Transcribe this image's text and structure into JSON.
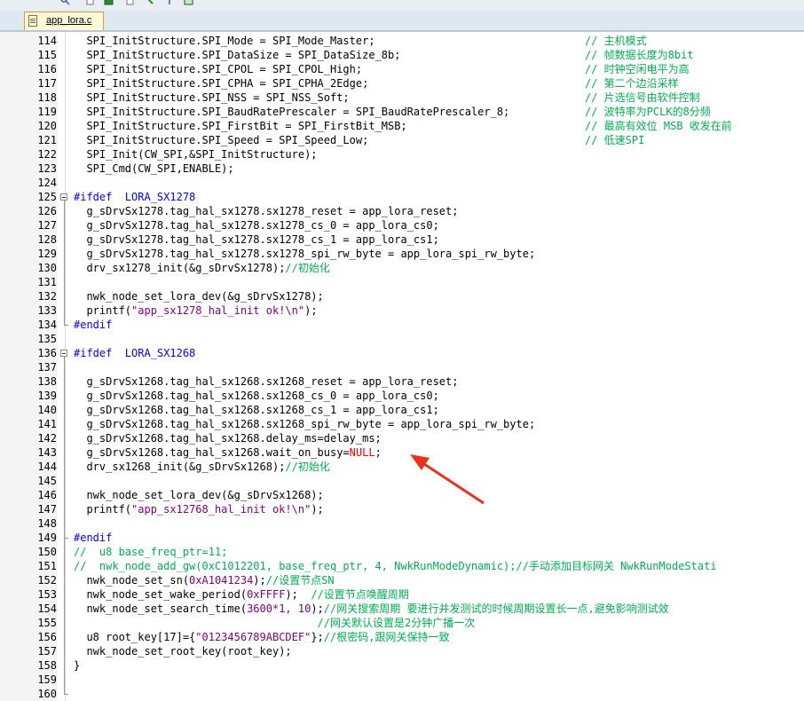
{
  "tab": {
    "label": "app_lora.c"
  },
  "toolbar": {
    "icons": [
      "find-icon",
      "page-icon",
      "bookmark-icon",
      "down-icon",
      "wrench-icon",
      "window-icon"
    ]
  },
  "colors": {
    "code": "#000000",
    "comment": "#00b050",
    "preprocessor": "#0000ff",
    "string": "#800080",
    "null": "#ff0000",
    "arrow": "#e8341c"
  },
  "lines": [
    {
      "n": "114",
      "code": "  SPI_InitStructure.SPI_Mode = SPI_Mode_Master;",
      "comment": "// 主机模式"
    },
    {
      "n": "115",
      "code": "  SPI_InitStructure.SPI_DataSize = SPI_DataSize_8b;",
      "comment": "// 帧数据长度为8bit"
    },
    {
      "n": "116",
      "code": "  SPI_InitStructure.SPI_CPOL = SPI_CPOL_High;",
      "comment": "// 时钟空闲电平为高"
    },
    {
      "n": "117",
      "code": "  SPI_InitStructure.SPI_CPHA = SPI_CPHA_2Edge;",
      "comment": "// 第二个边沿采样"
    },
    {
      "n": "118",
      "code": "  SPI_InitStructure.SPI_NSS = SPI_NSS_Soft;",
      "comment": "// 片选信号由软件控制"
    },
    {
      "n": "119",
      "code": "  SPI_InitStructure.SPI_BaudRatePrescaler = SPI_BaudRatePrescaler_8;",
      "comment": "// 波特率为PCLK的8分频"
    },
    {
      "n": "120",
      "code": "  SPI_InitStructure.SPI_FirstBit = SPI_FirstBit_MSB;",
      "comment": "// 最高有效位 MSB 收发在前"
    },
    {
      "n": "121",
      "code": "  SPI_InitStructure.SPI_Speed = SPI_Speed_Low;",
      "comment": "// 低速SPI"
    },
    {
      "n": "122",
      "code": "  SPI_Init(CW_SPI,&SPI_InitStructure);"
    },
    {
      "n": "123",
      "code": "  SPI_Cmd(CW_SPI,ENABLE);"
    },
    {
      "n": "124",
      "code": ""
    },
    {
      "n": "125",
      "code": "#ifdef  LORA_SX1278",
      "pp": true
    },
    {
      "n": "126",
      "code": "  g_sDrvSx1278.tag_hal_sx1278.sx1278_reset = app_lora_reset;"
    },
    {
      "n": "127",
      "code": "  g_sDrvSx1278.tag_hal_sx1278.sx1278_cs_0 = app_lora_cs0;"
    },
    {
      "n": "128",
      "code": "  g_sDrvSx1278.tag_hal_sx1278.sx1278_cs_1 = app_lora_cs1;"
    },
    {
      "n": "129",
      "code": "  g_sDrvSx1278.tag_hal_sx1278.sx1278_spi_rw_byte = app_lora_spi_rw_byte;"
    },
    {
      "n": "130",
      "code": "  drv_sx1278_init(&g_sDrvSx1278);",
      "tail": "//初始化"
    },
    {
      "n": "131",
      "code": ""
    },
    {
      "n": "132",
      "code": "  nwk_node_set_lora_dev(&g_sDrvSx1278);"
    },
    {
      "n": "133",
      "code": "  printf(",
      "str": "\"app_sx1278_hal_init ok!\\n\"",
      "after": ");"
    },
    {
      "n": "134",
      "code": "#endif",
      "pp": true
    },
    {
      "n": "135",
      "code": ""
    },
    {
      "n": "136",
      "code": "#ifdef  LORA_SX1268",
      "pp": true
    },
    {
      "n": "137",
      "code": ""
    },
    {
      "n": "138",
      "code": "  g_sDrvSx1268.tag_hal_sx1268.sx1268_reset = app_lora_reset;"
    },
    {
      "n": "139",
      "code": "  g_sDrvSx1268.tag_hal_sx1268.sx1268_cs_0 = app_lora_cs0;"
    },
    {
      "n": "140",
      "code": "  g_sDrvSx1268.tag_hal_sx1268.sx1268_cs_1 = app_lora_cs1;"
    },
    {
      "n": "141",
      "code": "  g_sDrvSx1268.tag_hal_sx1268.sx1268_spi_rw_byte = app_lora_spi_rw_byte;"
    },
    {
      "n": "142",
      "code": "  g_sDrvSx1268.tag_hal_sx1268.delay_ms=delay_ms;"
    },
    {
      "n": "143",
      "code": "  g_sDrvSx1268.tag_hal_sx1268.wait_on_busy=",
      "null": "NULL",
      "after": ";"
    },
    {
      "n": "144",
      "code": "  drv_sx1268_init(&g_sDrvSx1268);",
      "tail": "//初始化"
    },
    {
      "n": "145",
      "code": ""
    },
    {
      "n": "146",
      "code": "  nwk_node_set_lora_dev(&g_sDrvSx1268);"
    },
    {
      "n": "147",
      "code": "  printf(",
      "str": "\"app_sx12768_hal_init ok!\\n\"",
      "after": ");"
    },
    {
      "n": "148",
      "code": ""
    },
    {
      "n": "149",
      "code": "#endif",
      "pp": true
    },
    {
      "n": "150",
      "code": "//  u8 base_freq_ptr=11;",
      "allcmt": true
    },
    {
      "n": "151",
      "code": "//  nwk_node_add_gw(0xC1012201, base_freq_ptr, 4, NwkRunModeDynamic);//手动添加目标网关 NwkRunModeStati",
      "allcmt": true
    },
    {
      "n": "152",
      "code": "  nwk_node_set_sn(",
      "num": "0xA1041234",
      "after": ");",
      "tail": "//设置节点SN"
    },
    {
      "n": "153",
      "code": "  nwk_node_set_wake_period(",
      "num": "0xFFFF",
      "after": ");  ",
      "tail": "//设置节点唤醒周期"
    },
    {
      "n": "154",
      "code": "  nwk_node_set_search_time(",
      "num": "3600*1, 10",
      "after": ");",
      "tail": "//网关搜索周期 要进行并发测试的时候周期设置长一点,避免影响测试效"
    },
    {
      "n": "155",
      "code": "                                      ",
      "tail": "//网关默认设置是2分钟广播一次"
    },
    {
      "n": "156",
      "code": "  u8 root_key[17]={",
      "str": "\"0123456789ABCDEF\"",
      "after": "};",
      "tail": "//根密码,跟网关保持一致"
    },
    {
      "n": "157",
      "code": "  nwk_node_set_root_key(root_key);"
    },
    {
      "n": "158",
      "code": "}"
    },
    {
      "n": "159",
      "code": ""
    },
    {
      "n": "160",
      "code": ""
    }
  ]
}
